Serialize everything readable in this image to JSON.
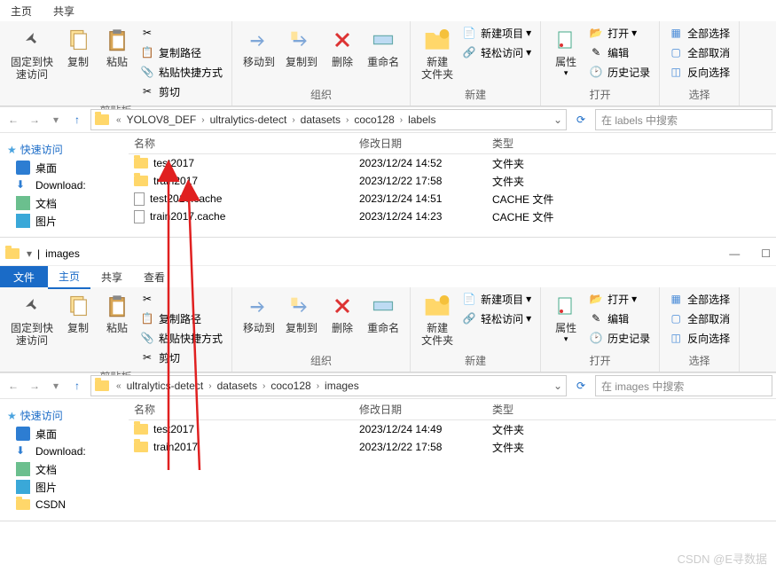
{
  "tabs": {
    "file": "文件",
    "home": "主页",
    "share": "共享",
    "view": "查看"
  },
  "ribbon": {
    "pin": "固定到快\n速访问",
    "copy": "复制",
    "paste": "粘贴",
    "cut": "剪切",
    "copy_path": "复制路径",
    "paste_shortcut": "粘贴快捷方式",
    "clipboard_group": "剪贴板",
    "move_to": "移动到",
    "copy_to": "复制到",
    "delete": "删除",
    "rename": "重命名",
    "organize_group": "组织",
    "new_folder": "新建\n文件夹",
    "new_item": "新建项目",
    "easy_access": "轻松访问",
    "new_group": "新建",
    "properties": "属性",
    "open": "打开",
    "edit": "编辑",
    "history": "历史记录",
    "open_group": "打开",
    "select_all": "全部选择",
    "select_none": "全部取消",
    "invert": "反向选择",
    "select_group": "选择"
  },
  "window1": {
    "breadcrumb": [
      "YOLOV8_DEF",
      "ultralytics-detect",
      "datasets",
      "coco128",
      "labels"
    ],
    "search_placeholder": "在 labels 中搜索",
    "headers": {
      "name": "名称",
      "date": "修改日期",
      "type": "类型"
    },
    "files": [
      {
        "name": "test2017",
        "date": "2023/12/24 14:52",
        "type": "文件夹",
        "icon": "folder"
      },
      {
        "name": "train2017",
        "date": "2023/12/22 17:58",
        "type": "文件夹",
        "icon": "folder"
      },
      {
        "name": "test2017.cache",
        "date": "2023/12/24 14:51",
        "type": "CACHE 文件",
        "icon": "file"
      },
      {
        "name": "train2017.cache",
        "date": "2023/12/24 14:23",
        "type": "CACHE 文件",
        "icon": "file"
      }
    ]
  },
  "window2": {
    "title": "images",
    "breadcrumb": [
      "ultralytics-detect",
      "datasets",
      "coco128",
      "images"
    ],
    "search_placeholder": "在 images 中搜索",
    "headers": {
      "name": "名称",
      "date": "修改日期",
      "type": "类型"
    },
    "files": [
      {
        "name": "test2017",
        "date": "2023/12/24 14:49",
        "type": "文件夹",
        "icon": "folder"
      },
      {
        "name": "train2017",
        "date": "2023/12/22 17:58",
        "type": "文件夹",
        "icon": "folder"
      }
    ]
  },
  "sidebar": {
    "quick_access": "快速访问",
    "items1": [
      {
        "label": "桌面",
        "icon": "desktop"
      },
      {
        "label": "Download:",
        "icon": "download"
      },
      {
        "label": "文档",
        "icon": "doc"
      },
      {
        "label": "图片",
        "icon": "pic"
      }
    ],
    "items2": [
      {
        "label": "桌面",
        "icon": "desktop"
      },
      {
        "label": "Download:",
        "icon": "download"
      },
      {
        "label": "文档",
        "icon": "doc"
      },
      {
        "label": "图片",
        "icon": "pic"
      },
      {
        "label": "CSDN",
        "icon": "folder"
      }
    ]
  },
  "watermark": "CSDN @E寻数据"
}
